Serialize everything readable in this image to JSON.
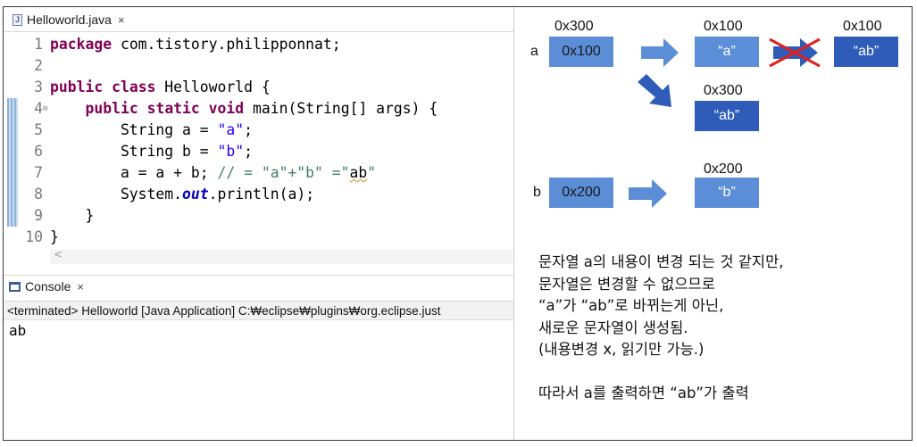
{
  "editor": {
    "tab_title": "Helloworld.java",
    "tab_close": "×",
    "tab_icon": "java-file-icon",
    "lines": [
      {
        "num": "1",
        "parts": [
          [
            "kw",
            "package"
          ],
          [
            "plain",
            " com.tistory.philipponnat;"
          ]
        ]
      },
      {
        "num": "2",
        "parts": []
      },
      {
        "num": "3",
        "parts": [
          [
            "kw",
            "public"
          ],
          [
            "plain",
            " "
          ],
          [
            "kw",
            "class"
          ],
          [
            "plain",
            " Helloworld {"
          ]
        ]
      },
      {
        "num": "4",
        "fold": "⊖",
        "parts": [
          [
            "plain",
            "    "
          ],
          [
            "kw",
            "public"
          ],
          [
            "plain",
            " "
          ],
          [
            "kw",
            "static"
          ],
          [
            "plain",
            " "
          ],
          [
            "kw",
            "void"
          ],
          [
            "plain",
            " main(String[] args) {"
          ]
        ]
      },
      {
        "num": "5",
        "parts": [
          [
            "plain",
            "        String a = "
          ],
          [
            "str",
            "\"a\""
          ],
          [
            "plain",
            ";"
          ]
        ]
      },
      {
        "num": "6",
        "parts": [
          [
            "plain",
            "        String b = "
          ],
          [
            "str",
            "\"b\""
          ],
          [
            "plain",
            ";"
          ]
        ]
      },
      {
        "num": "7",
        "parts": [
          [
            "plain",
            "        a = a + b; "
          ],
          [
            "cmt",
            "// = \"a\"+\"b\" =\""
          ],
          [
            "sq",
            "ab"
          ],
          [
            "cmt",
            "\""
          ]
        ]
      },
      {
        "num": "8",
        "parts": [
          [
            "plain",
            "        System."
          ],
          [
            "stat",
            "out"
          ],
          [
            "plain",
            ".println(a);"
          ]
        ]
      },
      {
        "num": "9",
        "parts": [
          [
            "plain",
            "    }"
          ]
        ]
      },
      {
        "num": "10",
        "parts": [
          [
            "plain",
            "}"
          ]
        ]
      }
    ],
    "scroll_arrow": "<"
  },
  "console": {
    "tab_title": "Console",
    "tab_close": "×",
    "status": "<terminated> Helloworld [Java Application] C:₩eclipse₩plugins₩org.eclipse.just",
    "output": "ab"
  },
  "diagram": {
    "var_a": "a",
    "var_b": "b",
    "addr_a_label": "0x300",
    "addr_a_old": "0x100",
    "box1_addr": "0x100",
    "box1_value": "“a”",
    "box2_addr": "0x100",
    "box2_value": "“ab”",
    "box3_addr": "0x300",
    "box3_value": "“ab”",
    "b_ref": "0x200",
    "box4_addr": "0x200",
    "box4_value": "“b”",
    "colors": {
      "light_box": "#5b8ed6",
      "dark_box": "#2e5cb8",
      "arrow": "#5b8ed6",
      "arrow_dark": "#2e5cb8",
      "cross": "#e02020"
    }
  },
  "notes": [
    "문자열 a의 내용이 변경 되는 것 같지만,",
    "문자열은 변경할 수 없으므로",
    "“a”가 “ab”로 바뀌는게 아닌,",
    "새로운 문자열이 생성됨.",
    "(내용변경 x, 읽기만 가능.)",
    "",
    "따라서 a를 출력하면 “ab”가 출력"
  ]
}
